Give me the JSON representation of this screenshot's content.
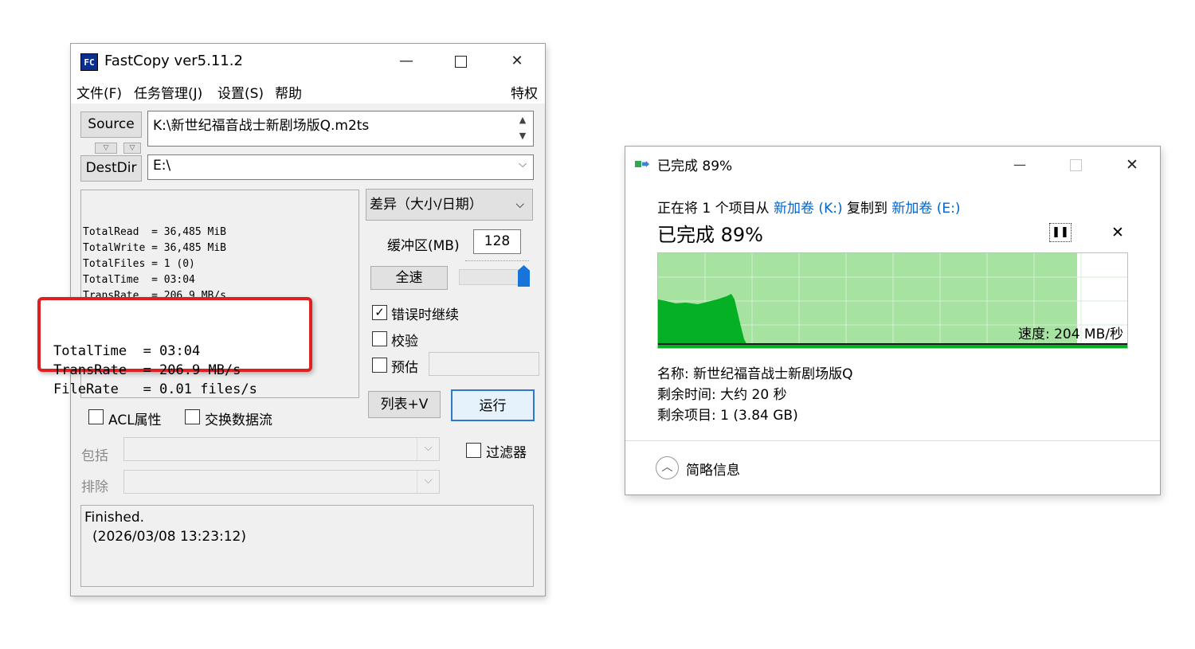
{
  "fastcopy": {
    "title": "FastCopy ver5.11.2",
    "logo": "FC",
    "menu": [
      "文件(F)",
      "任务管理(J)",
      "设置(S)",
      "帮助"
    ],
    "menu_right": "特权",
    "source_label": "Source",
    "source_value": "K:\\新世纪福音战士新剧场版Q.m2ts",
    "destdir_label": "DestDir",
    "dest_value": "E:\\",
    "mode_select": "差异（大小/日期）",
    "buffer_label": "缓冲区(MB)",
    "buffer_value": "128",
    "fullspeed_label": "全速",
    "speed_slider_level": 1.0,
    "status_lines": [
      "TotalRead  = 36,485 MiB",
      "TotalWrite = 36,485 MiB",
      "TotalFiles = 1 (0)",
      "TotalTime  = 03:04",
      "TransRate  = 206.9 MB/s",
      "FileRate   = 0.01 files/s"
    ],
    "highlight_lines": [
      "TotalTime  = 03:04",
      "TransRate  = 206.9 MB/s",
      "FileRate   = 0.01 files/s"
    ],
    "continue_on_error": {
      "label": "错误时继续",
      "checked": true
    },
    "verify": {
      "label": "校验",
      "checked": false
    },
    "estimate": {
      "label": "预估",
      "checked": false
    },
    "list_button": "列表+V",
    "run_button": "运行",
    "acl": {
      "label": "ACL属性",
      "checked": false
    },
    "streams": {
      "label": "交换数据流",
      "checked": false
    },
    "filter": {
      "label": "过滤器",
      "checked": false
    },
    "include_label": "包括",
    "exclude_label": "排除",
    "log_line1": "Finished.",
    "log_line2": "(2026/03/08 13:23:12)"
  },
  "copy_dialog": {
    "title": "已完成 89%",
    "desc_prefix": "正在将 1 个项目从 ",
    "desc_src": "新加卷 (K:)",
    "desc_mid": " 复制到 ",
    "desc_dst": "新加卷 (E:)",
    "headline": "已完成 89%",
    "progress": 0.89,
    "speed_text": "速度: 204 MB/秒",
    "name_line": "名称: 新世纪福音战士新剧场版Q",
    "time_line": "剩余时间: 大约 20 秒",
    "items_line": "剩余项目: 1 (3.84 GB)",
    "details_label": "简略信息",
    "colors": {
      "graph_fill": "#a6e3a1",
      "graph_dark": "#06b025",
      "link": "#0066cc"
    }
  }
}
